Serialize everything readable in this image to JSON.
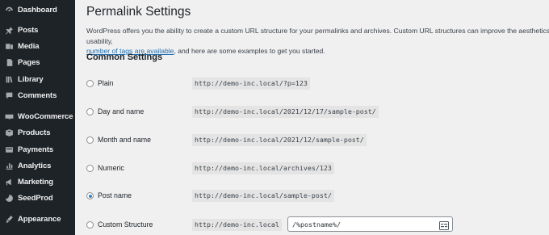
{
  "sidebar": {
    "items": [
      {
        "label": "Dashboard",
        "icon": "dashboard-icon"
      },
      {
        "label": "Posts",
        "icon": "pin-icon"
      },
      {
        "label": "Media",
        "icon": "media-icon"
      },
      {
        "label": "Pages",
        "icon": "pages-icon"
      },
      {
        "label": "Library",
        "icon": "library-icon"
      },
      {
        "label": "Comments",
        "icon": "comments-icon"
      },
      {
        "label": "WooCommerce",
        "icon": "woocommerce-icon"
      },
      {
        "label": "Products",
        "icon": "products-icon"
      },
      {
        "label": "Payments",
        "icon": "payments-icon"
      },
      {
        "label": "Analytics",
        "icon": "analytics-icon"
      },
      {
        "label": "Marketing",
        "icon": "marketing-icon"
      },
      {
        "label": "SeedProd",
        "icon": "seedprod-icon"
      },
      {
        "label": "Appearance",
        "icon": "appearance-icon"
      }
    ]
  },
  "main": {
    "title": "Permalink Settings",
    "intro_text": "WordPress offers you the ability to create a custom URL structure for your permalinks and archives. Custom URL structures can improve the aesthetics, usability,",
    "intro_link": "number of tags are available",
    "intro_tail": ", and here are some examples to get you started.",
    "section_title": "Common Settings",
    "options": [
      {
        "label": "Plain",
        "example": "http://demo-inc.local/?p=123",
        "checked": false
      },
      {
        "label": "Day and name",
        "example": "http://demo-inc.local/2021/12/17/sample-post/",
        "checked": false
      },
      {
        "label": "Month and name",
        "example": "http://demo-inc.local/2021/12/sample-post/",
        "checked": false
      },
      {
        "label": "Numeric",
        "example": "http://demo-inc.local/archives/123",
        "checked": false
      },
      {
        "label": "Post name",
        "example": "http://demo-inc.local/sample-post/",
        "checked": true
      }
    ],
    "custom": {
      "label": "Custom Structure",
      "base": "http://demo-inc.local",
      "value": "/%postname%/"
    }
  },
  "colors": {
    "sidebar_bg": "#1d2327",
    "page_bg": "#f0f0f1",
    "accent": "#2271b1",
    "radio_checked": "#3582c4"
  }
}
